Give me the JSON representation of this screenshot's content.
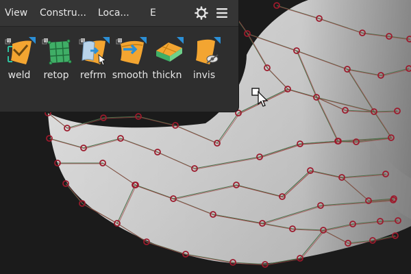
{
  "menu": {
    "items": [
      "View",
      "Constru...",
      "Loca...",
      "E"
    ],
    "settings_icon": "gear-icon",
    "menu_icon": "hamburger-icon"
  },
  "tools": [
    {
      "label": "weld",
      "icon": "weld-icon"
    },
    {
      "label": "retop",
      "icon": "retopo-icon"
    },
    {
      "label": "refrm",
      "icon": "reform-icon"
    },
    {
      "label": "smooth",
      "icon": "smooth-icon"
    },
    {
      "label": "thickn",
      "icon": "thicken-icon"
    },
    {
      "label": "invis",
      "icon": "invisible-icon"
    }
  ],
  "colors": {
    "panel": "#2e2e2e",
    "menubar": "#353535",
    "accent_blue": "#2b8fd6",
    "tool_orange": "#f3a531",
    "mesh_vertex": "#9c1a2c",
    "surface": "#d6d6d6"
  }
}
